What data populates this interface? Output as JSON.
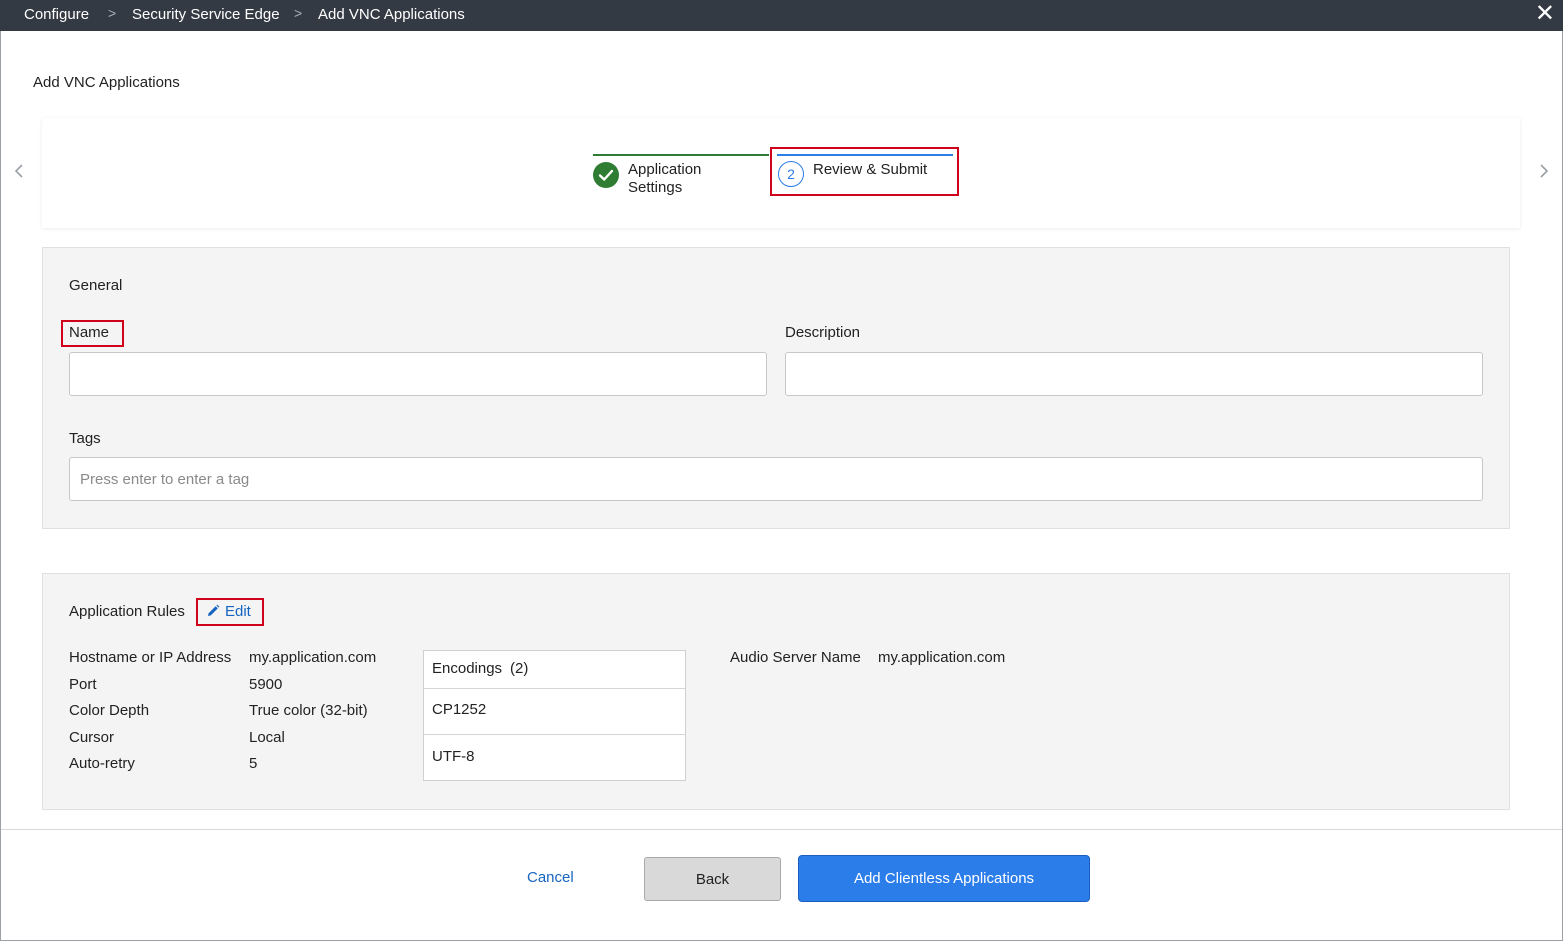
{
  "breadcrumb": {
    "items": [
      "Configure",
      "Security Service Edge",
      "Add VNC Applications"
    ],
    "separator": ">"
  },
  "window": {
    "close_icon": "close-icon"
  },
  "page_title": "Add VNC Applications",
  "stepper": {
    "prev_icon": "chevron-left-icon",
    "next_icon": "chevron-right-icon",
    "steps": [
      {
        "label_line1": "Application",
        "label_line2": "Settings",
        "status": "complete",
        "icon": "check-circle-icon"
      },
      {
        "number": "2",
        "label": "Review & Submit",
        "status": "active"
      }
    ]
  },
  "general": {
    "heading": "General",
    "name_label": "Name",
    "name_value": "",
    "description_label": "Description",
    "description_value": "",
    "tags_label": "Tags",
    "tags_placeholder": "Press enter to enter a tag"
  },
  "rules": {
    "heading": "Application Rules",
    "edit_label": "Edit",
    "fields": [
      {
        "key": "Hostname or IP Address",
        "value": "my.application.com"
      },
      {
        "key": "Port",
        "value": "5900"
      },
      {
        "key": "Color Depth",
        "value": "True color (32-bit)"
      },
      {
        "key": "Cursor",
        "value": "Local"
      },
      {
        "key": "Auto-retry",
        "value": "5"
      }
    ],
    "encodings": {
      "header": "Encodings",
      "count": "(2)",
      "items": [
        "CP1252",
        "UTF-8"
      ]
    },
    "audio_server_label": "Audio Server Name",
    "audio_server_value": "my.application.com"
  },
  "footer": {
    "cancel_label": "Cancel",
    "back_label": "Back",
    "submit_label": "Add Clientless Applications"
  },
  "colors": {
    "topbar": "#343a43",
    "accent": "#2b7de9",
    "complete": "#2e7d32",
    "highlight": "#d0021b",
    "link": "#1565c0"
  }
}
